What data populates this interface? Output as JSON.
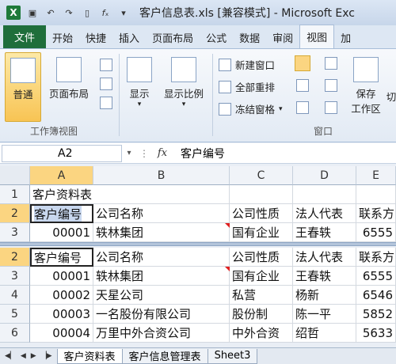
{
  "window": {
    "title": "客户信息表.xls [兼容模式] - Microsoft Exc",
    "app_icon": "excel-icon"
  },
  "ribbon_tabs": [
    "文件",
    "开始",
    "快捷",
    "插入",
    "页面布局",
    "公式",
    "数据",
    "审阅",
    "视图",
    "加"
  ],
  "ribbon": {
    "normal": "普通",
    "page_layout": "页面布局",
    "show": "显示",
    "zoom": "显示比例",
    "new_window": "新建窗口",
    "arrange_all": "全部重排",
    "freeze_panes": "冻结窗格",
    "save_workspace_line1": "保存",
    "save_workspace_line2": "工作区",
    "switch": "切",
    "group_workbook_views": "工作簿视图",
    "group_window": "窗口"
  },
  "formula_bar": {
    "name_box": "A2",
    "fx": "fx",
    "value": "客户编号"
  },
  "columns": [
    "A",
    "B",
    "C",
    "D",
    "E"
  ],
  "top_pane": {
    "rows": [
      {
        "num": "1",
        "cells": [
          "客户资料表",
          "",
          "",
          "",
          ""
        ]
      },
      {
        "num": "2",
        "cells": [
          "客户编号",
          "公司名称",
          "公司性质",
          "法人代表",
          "联系方"
        ]
      },
      {
        "num": "3",
        "cells": [
          "00001",
          "轶林集团",
          "国有企业",
          "王春轶",
          "6555"
        ]
      }
    ]
  },
  "bottom_pane": {
    "rows": [
      {
        "num": "2",
        "cells": [
          "客户编号",
          "公司名称",
          "公司性质",
          "法人代表",
          "联系方"
        ]
      },
      {
        "num": "3",
        "cells": [
          "00001",
          "轶林集团",
          "国有企业",
          "王春轶",
          "6555"
        ]
      },
      {
        "num": "4",
        "cells": [
          "00002",
          "天星公司",
          "私营",
          "杨新",
          "6546"
        ]
      },
      {
        "num": "5",
        "cells": [
          "00003",
          "一名股份有限公司",
          "股份制",
          "陈一平",
          "5852"
        ]
      },
      {
        "num": "6",
        "cells": [
          "00004",
          "万里中外合资公司",
          "中外合资",
          "绍哲",
          "5633"
        ]
      }
    ]
  },
  "sheet_tabs": [
    "客户资料表",
    "客户信息管理表",
    "Sheet3"
  ]
}
